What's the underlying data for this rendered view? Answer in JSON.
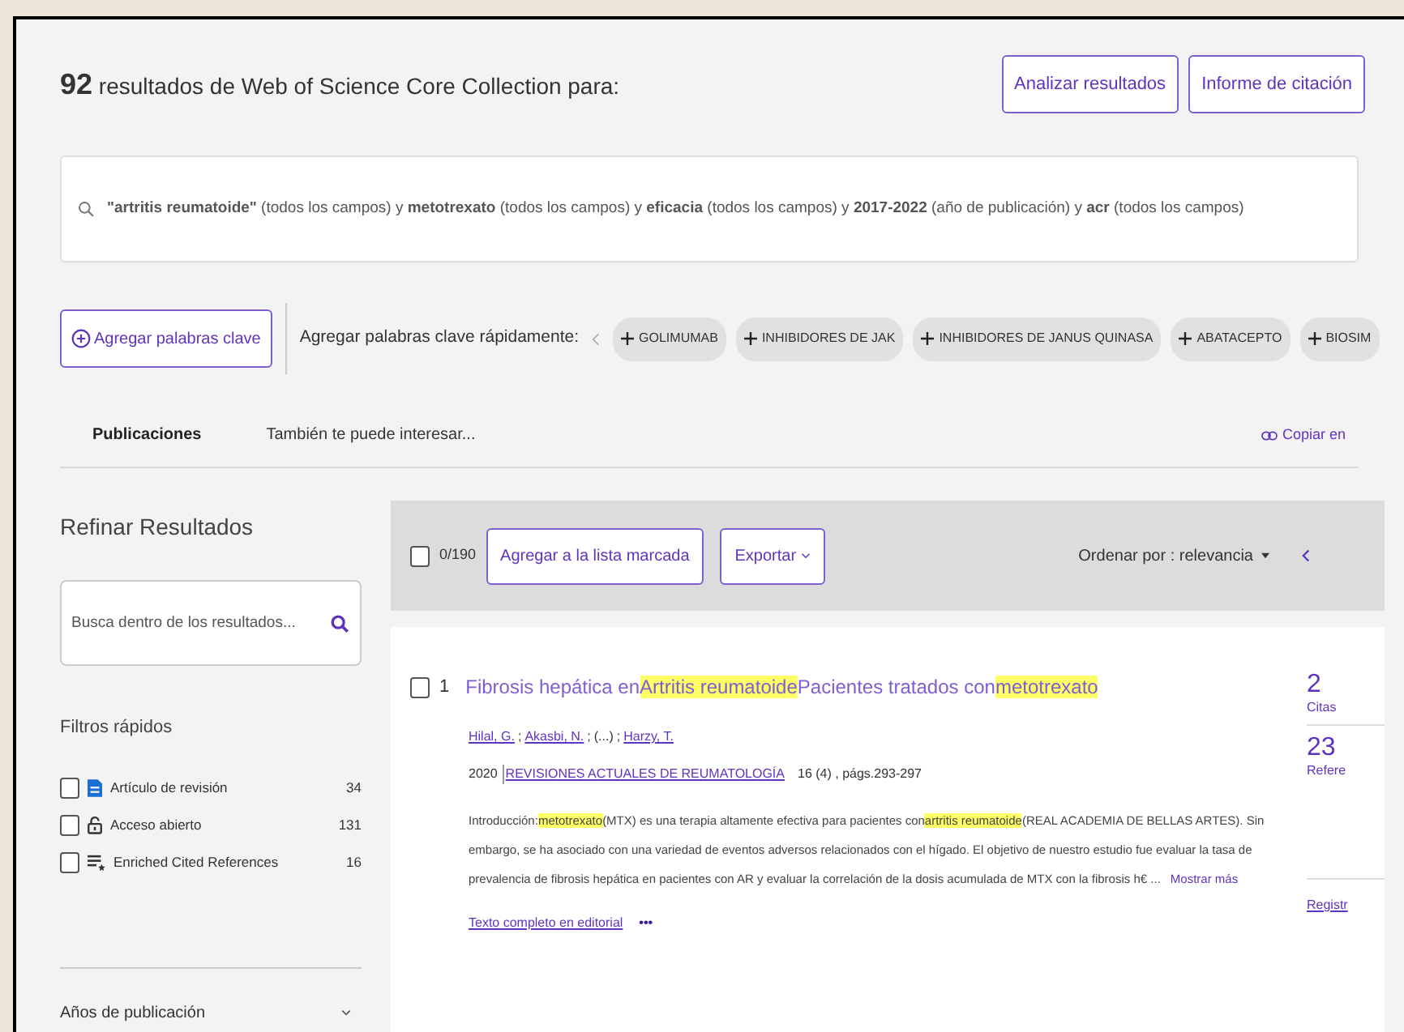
{
  "header": {
    "count": "92",
    "text": "resultados de Web of Science Core Collection para:",
    "buttons": [
      "Analizar resultados",
      "Informe de citación"
    ]
  },
  "query": "**\"artritis reumatoide\"** (todos los campos) y **metotrexato** (todos los campos) y **eficacia** (todos los campos) y **2017-2022** (año de publicación) y **acr** (todos los campos)",
  "keywords": {
    "add_button": "Agregar palabras clave",
    "label": "Agregar palabras clave rápidamente:",
    "chips": [
      "GOLIMUMAB",
      "INHIBIDORES DE JAK",
      "INHIBIDORES DE JANUS QUINASA",
      "ABATACEPTO",
      "BIOSIM"
    ]
  },
  "tabs": [
    {
      "label": "Publicaciones",
      "selected": true
    },
    {
      "label": "También te puede interesar...",
      "selected": false
    }
  ],
  "copy_link": "Copiar en",
  "sidebar": {
    "title": "Refinar Resultados",
    "search_placeholder": "Busca dentro de los resultados...",
    "quick_filters_title": "Filtros rápidos",
    "filters": [
      {
        "kind": "review",
        "label": "Artículo de revisión",
        "count": "34",
        "checked": false
      },
      {
        "kind": "open",
        "label": "Acceso abierto",
        "count": "131",
        "checked": false
      },
      {
        "kind": "enriched",
        "label": "Enriched Cited References",
        "count": "16",
        "checked": false
      }
    ],
    "years_title": "Años de publicación"
  },
  "toolbar": {
    "select_all_checked": false,
    "selected_count": "0/190",
    "add_button": "Agregar a la lista marcada",
    "export_button": "Exportar",
    "sort": "Ordenar por : relevancia"
  },
  "result": {
    "number": "1",
    "checked": false,
    "title": [
      {
        "text": "Fibrosis hepática en",
        "highlight": false
      },
      {
        "text": "Artritis reumatoide",
        "highlight": true
      },
      {
        "text": "Pacientes tratados con",
        "highlight": false
      },
      {
        "text": "metotrexato",
        "highlight": true
      }
    ],
    "authors": [
      "Hilal, G.",
      "Akasbi, N.",
      "(...)",
      "Harzy, T."
    ],
    "author_separator": ";",
    "year": "2020",
    "journal": "REVISIONES ACTUALES DE REUMATOLOGÍA",
    "issue": "16 (4) , págs.293-297",
    "abstract": [
      {
        "text": "Introducción:",
        "highlight": false
      },
      {
        "text": "metotrexato",
        "highlight": true
      },
      {
        "text": "(MTX) es una terapia altamente efectiva para pacientes con",
        "highlight": false
      },
      {
        "text": "artritis reumatoide",
        "highlight": true
      },
      {
        "text": "(REAL ACADEMIA DE BELLAS ARTES). Sin embargo, se ha asociado con una variedad de eventos adversos relacionados con el hígado. El objetivo de nuestro estudio fue evaluar la tasa de prevalencia de fibrosis hepática en pacientes con AR y evaluar la correlación de la dosis acumulada de MTX con la fibrosis h€ ...",
        "highlight": false
      }
    ],
    "show_more": "Mostrar más",
    "full_text": "Texto completo en editorial",
    "more": "•••",
    "citations": "2",
    "citations_label": "Citas",
    "references": "23",
    "references_label": "Refere",
    "record_link": "Registr"
  }
}
